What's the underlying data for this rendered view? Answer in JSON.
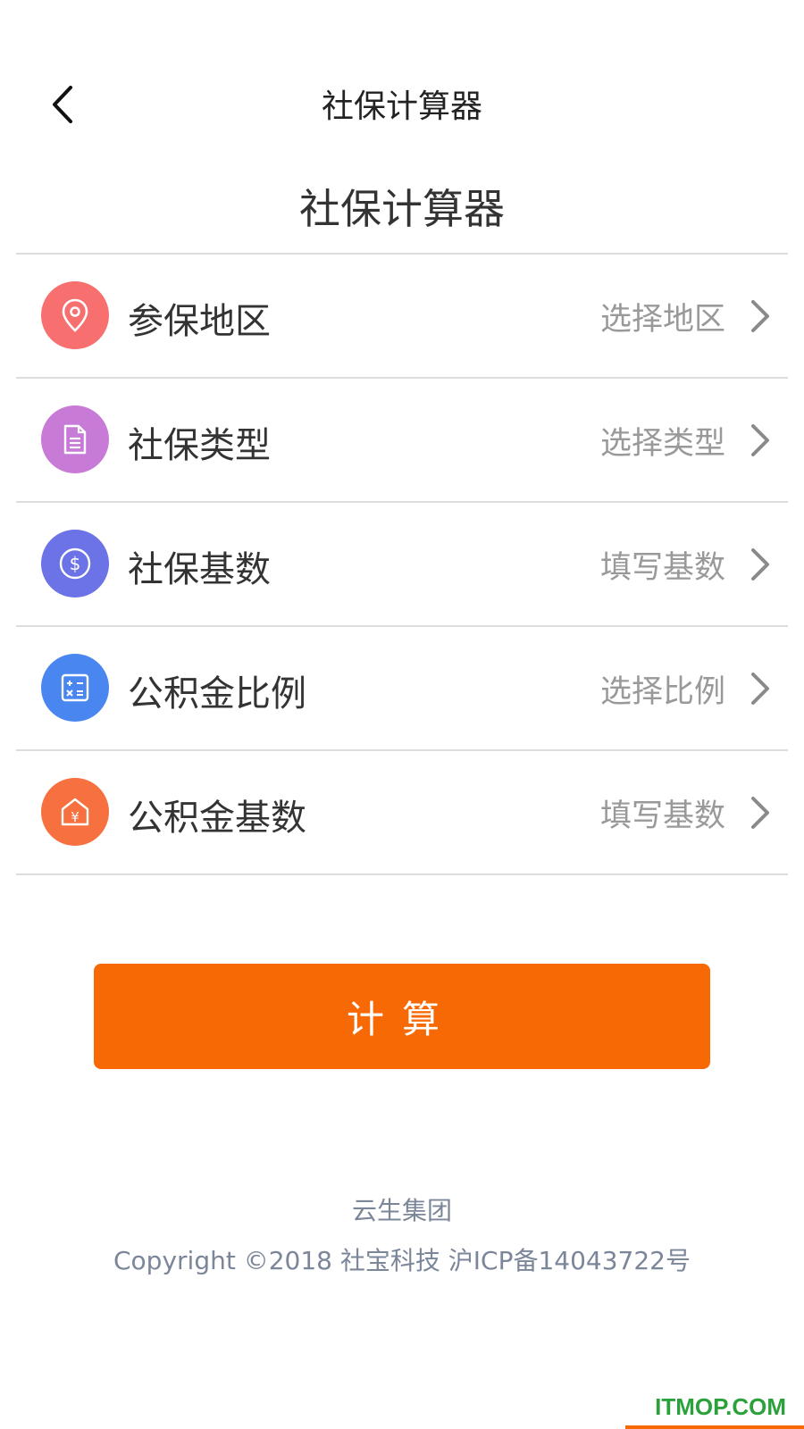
{
  "header": {
    "title": "社保计算器"
  },
  "section_title": "社保计算器",
  "rows": [
    {
      "label": "参保地区",
      "value": "选择地区",
      "icon": "location-pin-icon",
      "color": "#f86f6f"
    },
    {
      "label": "社保类型",
      "value": "选择类型",
      "icon": "document-icon",
      "color": "#c77ad6"
    },
    {
      "label": "社保基数",
      "value": "填写基数",
      "icon": "dollar-icon",
      "color": "#6b73e6"
    },
    {
      "label": "公积金比例",
      "value": "选择比例",
      "icon": "calculator-icon",
      "color": "#4a86f0"
    },
    {
      "label": "公积金基数",
      "value": "填写基数",
      "icon": "house-yen-icon",
      "color": "#f7703f"
    }
  ],
  "calculate_button": {
    "label": "计算",
    "color": "#f76904"
  },
  "footer": {
    "company": "云生集团",
    "copyright": "Copyright ©2018 社宝科技 沪ICP备14043722号"
  },
  "watermark": "ITMOP.COM"
}
